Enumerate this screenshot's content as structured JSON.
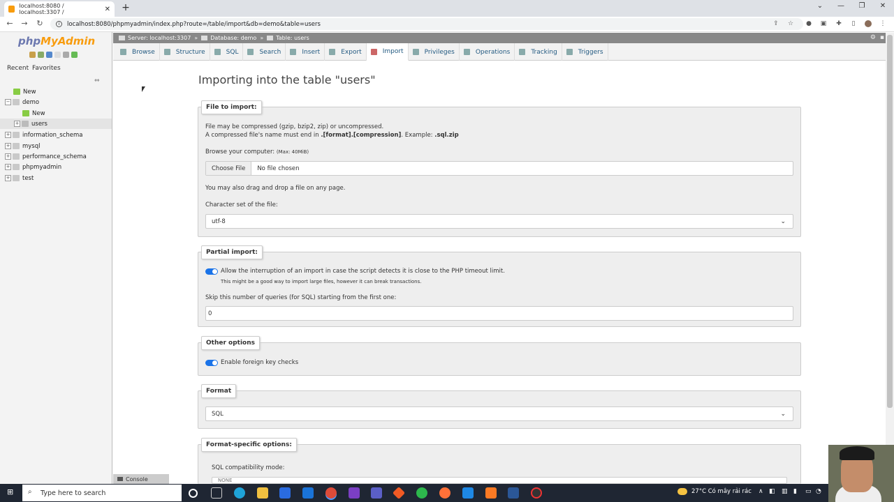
{
  "browser": {
    "tab_title": "localhost:8080 / localhost:3307 /",
    "url": "localhost:8080/phpmyadmin/index.php?route=/table/import&db=demo&table=users"
  },
  "sidebar": {
    "logo_a": "php",
    "logo_b": "MyAdmin",
    "tabs": [
      "Recent",
      "Favorites"
    ],
    "tree": [
      {
        "label": "New",
        "level": 0
      },
      {
        "label": "demo",
        "level": 0
      },
      {
        "label": "New",
        "level": 1
      },
      {
        "label": "users",
        "level": 1
      },
      {
        "label": "information_schema",
        "level": 0
      },
      {
        "label": "mysql",
        "level": 0
      },
      {
        "label": "performance_schema",
        "level": 0
      },
      {
        "label": "phpmyadmin",
        "level": 0
      },
      {
        "label": "test",
        "level": 0
      }
    ]
  },
  "breadcrumb": {
    "server": "Server: localhost:3307",
    "database": "Database: demo",
    "table": "Table: users"
  },
  "tabs": [
    "Browse",
    "Structure",
    "SQL",
    "Search",
    "Insert",
    "Export",
    "Import",
    "Privileges",
    "Operations",
    "Tracking",
    "Triggers"
  ],
  "active_tab": "Import",
  "page_title": "Importing into the table \"users\"",
  "file_import": {
    "legend": "File to import:",
    "line1": "File may be compressed (gzip, bzip2, zip) or uncompressed.",
    "line2_a": "A compressed file's name must end in ",
    "line2_b": ".[format].[compression]",
    "line2_c": ". Example: ",
    "line2_d": ".sql.zip",
    "browse_label": "Browse your computer:",
    "max_size": "(Max: 40MiB)",
    "choose_file": "Choose File",
    "no_file": "No file chosen",
    "drag_note": "You may also drag and drop a file on any page.",
    "charset_label": "Character set of the file:",
    "charset_value": "utf-8"
  },
  "partial_import": {
    "legend": "Partial import:",
    "allow_interrupt": "Allow the interruption of an import in case the script detects it is close to the PHP timeout limit.",
    "allow_interrupt_note": "This might be a good way to import large files, however it can break transactions.",
    "allow_interrupt_on": true,
    "skip_label": "Skip this number of queries (for SQL) starting from the first one:",
    "skip_value": "0"
  },
  "other_options": {
    "legend": "Other options",
    "fk_checks": "Enable foreign key checks",
    "fk_checks_on": true
  },
  "format": {
    "legend": "Format",
    "value": "SQL"
  },
  "format_specific": {
    "legend": "Format-specific options:",
    "compat_label": "SQL compatibility mode:",
    "compat_value": "NONE"
  },
  "console": "Console",
  "taskbar": {
    "search_placeholder": "Type here to search",
    "weather": "27°C  Có mây rải rác"
  }
}
